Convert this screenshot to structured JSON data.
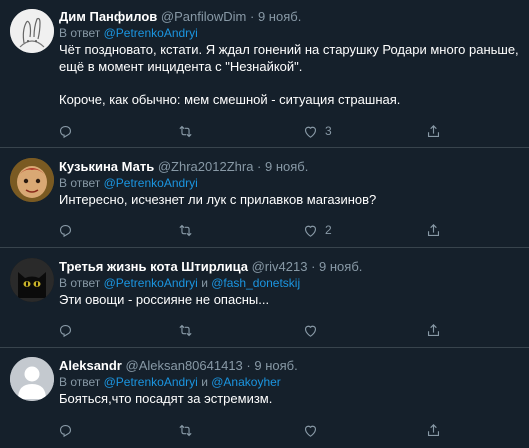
{
  "tweets": [
    {
      "name": "Дим Панфилов",
      "handle": "@PanfilowDim",
      "dot": "·",
      "time": "9 нояб.",
      "reply_prefix": "В ответ",
      "mentions": [
        "@PetrenkoAndryi"
      ],
      "reply_and": "",
      "text": [
        "Чёт поздновато, кстати. Я ждал гонений на старушку Родари много раньше, ещё в момент инцидента с \"Незнайкой\".",
        "Короче, как обычно: мем смешной - ситуация страшная."
      ],
      "reply_count": "",
      "retweet_count": "",
      "like_count": "3"
    },
    {
      "name": "Кузькина Мать",
      "handle": "@Zhra2012Zhra",
      "dot": "·",
      "time": "9 нояб.",
      "reply_prefix": "В ответ",
      "mentions": [
        "@PetrenkoAndryi"
      ],
      "reply_and": "",
      "text": [
        "Интересно, исчезнет ли лук с прилавков магазинов?"
      ],
      "reply_count": "",
      "retweet_count": "",
      "like_count": "2"
    },
    {
      "name": "Третья жизнь кота Штирлица",
      "handle": "@riv4213",
      "dot": "·",
      "time": "9 нояб.",
      "reply_prefix": "В ответ",
      "mentions": [
        "@PetrenkoAndryi",
        "@fash_donetskij"
      ],
      "reply_and": "и",
      "text": [
        "Эти овощи - россияне не опасны..."
      ],
      "reply_count": "",
      "retweet_count": "",
      "like_count": ""
    },
    {
      "name": "Aleksandr",
      "handle": "@Aleksan80641413",
      "dot": "·",
      "time": "9 нояб.",
      "reply_prefix": "В ответ",
      "mentions": [
        "@PetrenkoAndryi",
        "@Anakoyher"
      ],
      "reply_and": "и",
      "text": [
        "Бояться,что посадят за эстремизм."
      ],
      "reply_count": "",
      "retweet_count": "",
      "like_count": ""
    }
  ],
  "colors": {
    "background": "#15202b",
    "divider": "#38444d",
    "muted": "#8899a6",
    "link": "#1b95e0",
    "text": "#ffffff"
  },
  "icons": [
    "reply-icon",
    "retweet-icon",
    "like-icon",
    "share-icon"
  ]
}
